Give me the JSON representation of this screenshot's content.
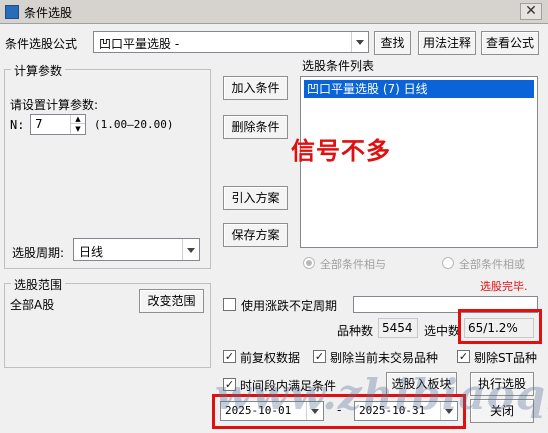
{
  "window": {
    "title": "条件选股",
    "close_glyph": "✕"
  },
  "formula": {
    "label": "条件选股公式",
    "selected": "凹口平量选股  -",
    "buttons": {
      "find": "查找",
      "usage": "用法注释",
      "view": "查看公式"
    }
  },
  "params": {
    "group_title": "计算参数",
    "prompt": "请设置计算参数:",
    "n_label": "N:",
    "n_value": "7",
    "n_range": "(1.00—20.00)",
    "period_label": "选股周期:",
    "period_value": "日线"
  },
  "actions": {
    "add": "加入条件",
    "delete": "删除条件",
    "import": "引入方案",
    "save": "保存方案"
  },
  "condition_list": {
    "title": "选股条件列表",
    "items": [
      "凹口平量选股 (7) 日线"
    ]
  },
  "annotation": {
    "text": "信号不多",
    "color": "#e01010"
  },
  "logic": {
    "all_and": "全部条件相与",
    "all_or": "全部条件相或"
  },
  "status": {
    "text": "选股完毕.",
    "color": "#e01010"
  },
  "scope": {
    "group_title": "选股范围",
    "value": "全部A股",
    "change_button": "改变范围"
  },
  "options": {
    "use_unfixed_period": "使用涨跌不定周期",
    "count_label": "品种数",
    "count_value": "5454",
    "selected_label": "选中数",
    "selected_value": "65/1.2%",
    "adjusted": "前复权数据",
    "exclude_untraded": "剔除当前未交易品种",
    "exclude_st": "剔除ST品种",
    "time_range": "时间段内满足条件",
    "check_glyph": "✓"
  },
  "dates": {
    "start": "2025-10-01",
    "separator": "-",
    "end": "2025-10-31"
  },
  "bottom_buttons": {
    "to_board": "选股入板块",
    "execute": "执行选股",
    "close": "关闭"
  },
  "watermark": "www.zhibiaoqi.com",
  "colors": {
    "selection": "#0a64d8",
    "highlight_box": "#e01010"
  }
}
